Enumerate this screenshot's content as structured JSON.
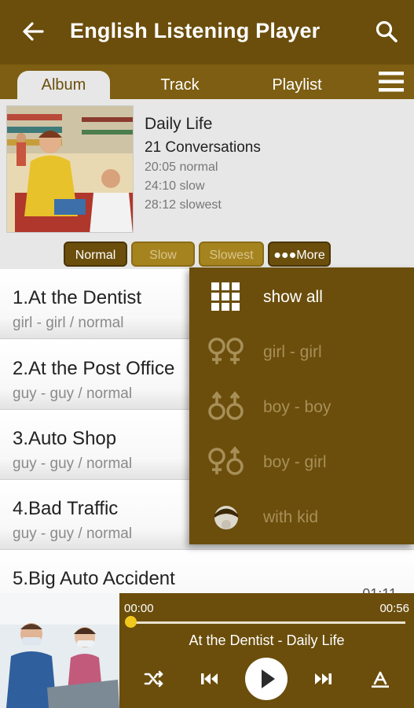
{
  "app": {
    "title": "English Listening Player"
  },
  "tabs": [
    {
      "label": "Album",
      "active": true
    },
    {
      "label": "Track",
      "active": false
    },
    {
      "label": "Playlist",
      "active": false
    }
  ],
  "album": {
    "name": "Daily Life",
    "count": "21 Conversations",
    "times": [
      "20:05 normal",
      "24:10 slow",
      "28:12 slowest"
    ]
  },
  "speed_buttons": {
    "normal": "Normal",
    "slow": "Slow",
    "slowest": "Slowest",
    "more": "●●●More"
  },
  "tracks": [
    {
      "title": "1.At the Dentist",
      "subtitle": "girl - girl / normal",
      "duration": ""
    },
    {
      "title": "2.At the Post Office",
      "subtitle": "guy - guy / normal",
      "duration": ""
    },
    {
      "title": "3.Auto Shop",
      "subtitle": "guy - guy / normal",
      "duration": ""
    },
    {
      "title": "4.Bad Traffic",
      "subtitle": "guy - guy / normal",
      "duration": ""
    },
    {
      "title": "5.Big Auto Accident",
      "subtitle": "",
      "duration": "01:11"
    }
  ],
  "filter_menu": {
    "items": [
      {
        "label": "show all",
        "icon": "grid-icon",
        "selected": true
      },
      {
        "label": "girl - girl",
        "icon": "female-female-icon",
        "selected": false
      },
      {
        "label": "boy - boy",
        "icon": "male-male-icon",
        "selected": false
      },
      {
        "label": "boy - girl",
        "icon": "female-male-icon",
        "selected": false
      },
      {
        "label": "with kid",
        "icon": "kid-icon",
        "selected": false
      }
    ]
  },
  "player": {
    "current": "00:00",
    "total": "00:56",
    "progress": 0.0,
    "now_playing": "At the Dentist - Daily Life"
  },
  "colors": {
    "primary": "#6b4e0c",
    "tab_bar": "#7d5e12",
    "accent": "#f2c81d",
    "muted_label": "#a78f58"
  }
}
